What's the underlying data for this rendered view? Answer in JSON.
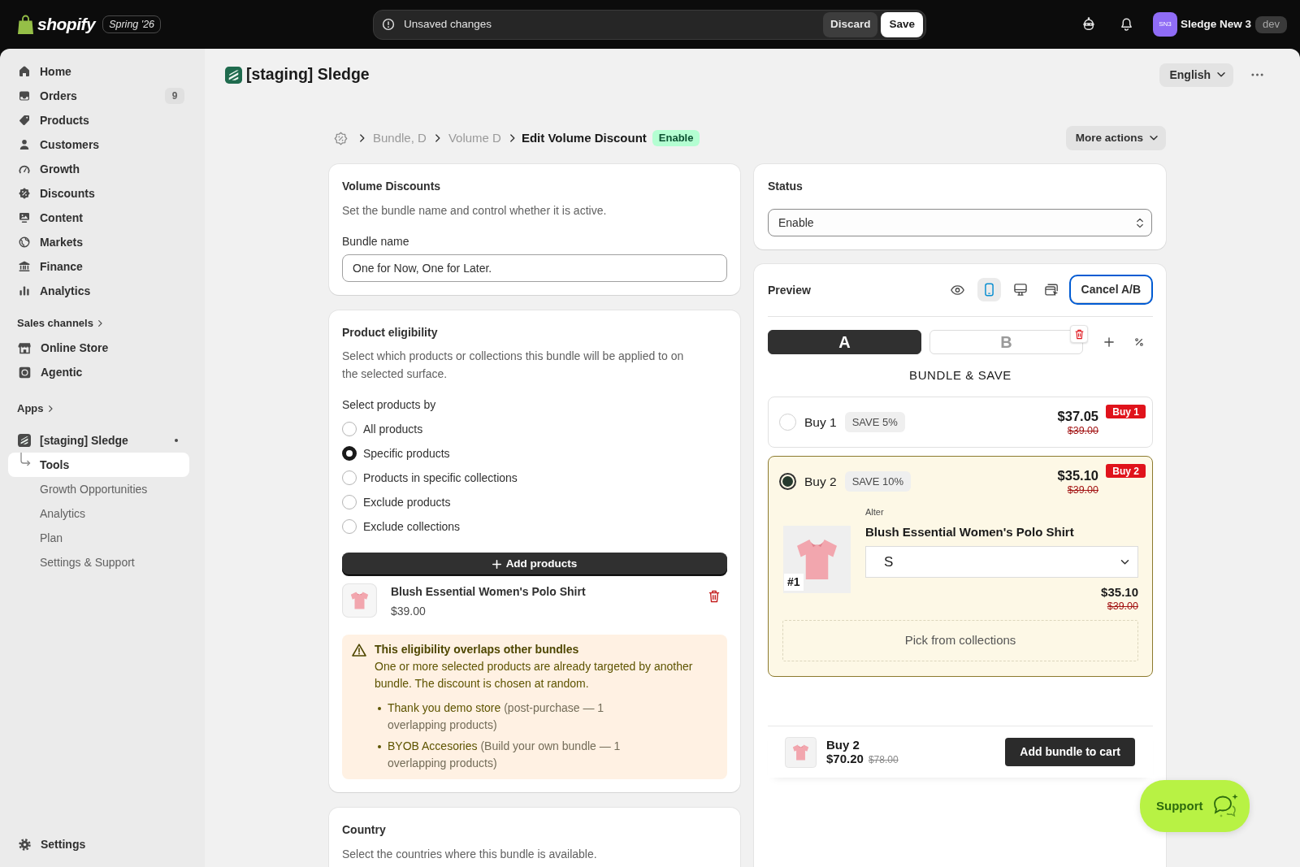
{
  "top_bar": {
    "logo_text": "shopify",
    "edition": "Spring '26",
    "save_bar": {
      "message": "Unsaved changes",
      "discard": "Discard",
      "save": "Save"
    },
    "store": {
      "initials": "SN3",
      "name": "Sledge New 3",
      "environment": "dev"
    }
  },
  "sidebar": {
    "items": [
      {
        "label": "Home",
        "selected": false
      },
      {
        "label": "Orders",
        "badge": "9",
        "selected": false
      },
      {
        "label": "Products",
        "selected": false
      },
      {
        "label": "Customers",
        "selected": false
      },
      {
        "label": "Growth",
        "selected": false
      },
      {
        "label": "Discounts",
        "selected": false
      },
      {
        "label": "Content",
        "selected": false
      },
      {
        "label": "Markets",
        "selected": false
      },
      {
        "label": "Finance",
        "selected": false
      },
      {
        "label": "Analytics",
        "selected": false
      }
    ],
    "sales_channels": {
      "heading": "Sales channels",
      "items": [
        {
          "label": "Online Store",
          "selected": false
        },
        {
          "label": "Agentic",
          "selected": false
        }
      ]
    },
    "apps": {
      "heading": "Apps",
      "items": [
        {
          "label": "[staging] Sledge",
          "selected": false,
          "children": [
            {
              "label": "Tools",
              "selected": true
            },
            {
              "label": "Growth Opportunities",
              "selected": false
            },
            {
              "label": "Analytics",
              "selected": false
            },
            {
              "label": "Plan",
              "selected": false
            },
            {
              "label": "Settings & Support",
              "selected": false
            }
          ]
        }
      ]
    },
    "settings": {
      "label": "Settings"
    }
  },
  "page_header": {
    "title": "[staging] Sledge",
    "language": "English"
  },
  "breadcrumb": {
    "items": [
      {
        "label": "Bundle, D"
      },
      {
        "label": "Volume D"
      }
    ],
    "current": "Edit Volume Discount",
    "status": "Enable",
    "more_actions": "More actions"
  },
  "volume_discounts": {
    "title": "Volume Discounts",
    "description": "Set the bundle name and control whether it is active.",
    "field": {
      "label": "Bundle name",
      "value": "One for Now, One for Later."
    }
  },
  "product_eligibility": {
    "title": "Product eligibility",
    "description": "Select which products or collections this bundle will be applied to on the selected surface.",
    "select_label": "Select products by",
    "options": [
      {
        "label": "All products",
        "selected": false
      },
      {
        "label": "Specific products",
        "selected": true
      },
      {
        "label": "Products in specific collections",
        "selected": false
      },
      {
        "label": "Exclude products",
        "selected": false
      },
      {
        "label": "Exclude collections",
        "selected": false
      }
    ],
    "add_button": "Add products",
    "products": [
      {
        "name": "Blush Essential Women's Polo Shirt",
        "price": "$39.00"
      }
    ],
    "warning": {
      "title": "This eligibility overlaps other bundles",
      "message": "One or more selected products are already targeted by another bundle. The discount is chosen at random.",
      "items": [
        {
          "name": "Thank you demo store",
          "detail": "(post-purchase — 1 overlapping products)"
        },
        {
          "name": "BYOB Accesories",
          "detail": "(Build your own bundle — 1 overlapping products)"
        }
      ]
    }
  },
  "country": {
    "title": "Country",
    "description": "Select the countries where this bundle is available."
  },
  "status_card": {
    "title": "Status",
    "value": "Enable"
  },
  "preview": {
    "title": "Preview",
    "device_buttons": [
      {
        "selected": false
      },
      {
        "selected": true
      },
      {
        "selected": false
      },
      {
        "selected": false
      }
    ],
    "cancel_ab": "Cancel A/B",
    "variants": [
      {
        "label": "A",
        "selected": true
      },
      {
        "label": "B",
        "selected": false
      }
    ],
    "widget": {
      "heading": "BUNDLE & SAVE",
      "tiers": [
        {
          "label": "Buy 1",
          "saving": "SAVE 5%",
          "price": "$37.05",
          "compare_price": "$39.00",
          "badge": "Buy 1",
          "selected": false
        },
        {
          "label": "Buy 2",
          "saving": "SAVE 10%",
          "price": "$35.10",
          "compare_price": "$39.00",
          "badge": "Buy 2",
          "selected": true,
          "details": {
            "caption": "Alter",
            "slots": [
              {
                "position": "#1",
                "product": "Blush Essential Women's Polo Shirt",
                "variant": "S",
                "price": "$35.10",
                "compare_price": "$39.00"
              }
            ],
            "collection_picker": "Pick from collections"
          }
        }
      ]
    },
    "cart_bar": {
      "quantity": "Buy 2",
      "total": "$70.20",
      "compare_total": "$78.00",
      "button": "Add bundle to cart"
    }
  },
  "support_button": {
    "label": "Support"
  }
}
